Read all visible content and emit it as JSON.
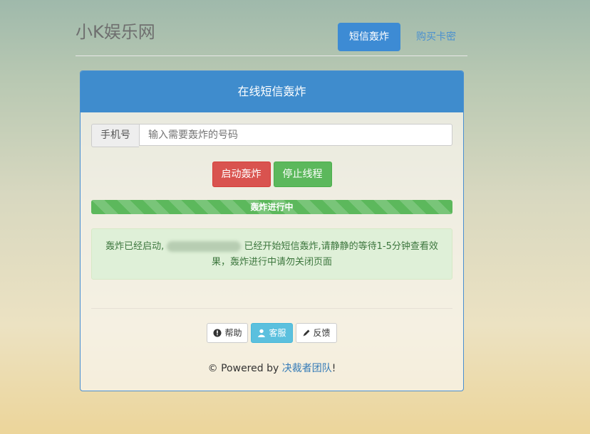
{
  "brand": "小K娱乐网",
  "nav": [
    {
      "label": "短信轰炸"
    },
    {
      "label": "购买卡密"
    }
  ],
  "panel": {
    "title": "在线短信轰炸",
    "phone_label": "手机号",
    "phone_placeholder": "输入需要轰炸的号码",
    "start_button": "启动轰炸",
    "stop_button": "停止线程",
    "progress": {
      "label": "轰炸进行中",
      "percent": 100
    },
    "message_before": "轰炸已经启动,",
    "message_after": "已经开始短信轰炸,请静静的等待1-5分钟查看效果，轰炸进行中请勿关闭页面"
  },
  "tools": [
    {
      "label": "帮助",
      "icon": "help-icon"
    },
    {
      "label": "客服",
      "icon": "user-icon"
    },
    {
      "label": "反馈",
      "icon": "pencil-icon"
    }
  ],
  "footer": {
    "prefix": "© Powered by ",
    "team": "决裁者团队",
    "suffix": "!"
  },
  "colors": {
    "primary": "#3f8ccd",
    "danger": "#d9534f",
    "success": "#5cb85c",
    "info": "#5bc0de"
  }
}
